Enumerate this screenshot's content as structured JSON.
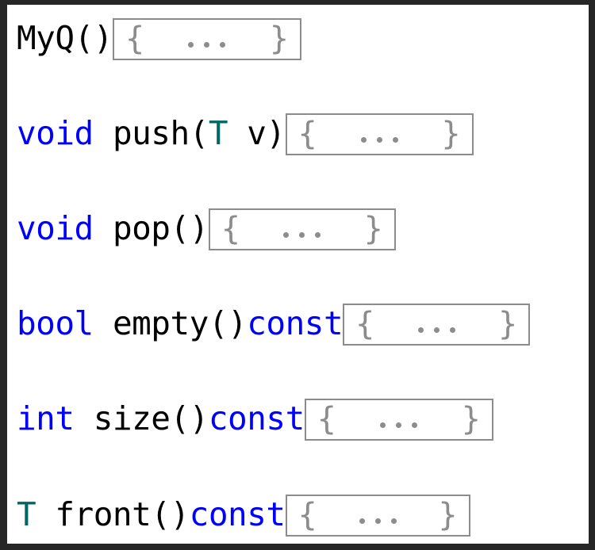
{
  "page": {
    "background_color": "#ffffff",
    "border_color": "#262626",
    "box_border_color": "#8c8c8c",
    "box_glyph_color": "#8c8c8c",
    "keyword_color": "#0000ff",
    "template_type_color": "#006666",
    "identifier_color": "#000000"
  },
  "code": {
    "language": "C++",
    "class_name": "MyQ",
    "members": [
      {
        "index": 0,
        "signature_text": "MyQ()",
        "tokens": [
          {
            "text": "MyQ",
            "kind": "identifier"
          },
          {
            "text": "()",
            "kind": "punctuation"
          }
        ],
        "body": {
          "open_brace": "{",
          "ellipsis": "...",
          "close_brace": "}",
          "dot_count": 3
        }
      },
      {
        "index": 1,
        "signature_text": "void push(T v)",
        "tokens": [
          {
            "text": "void",
            "kind": "keyword"
          },
          {
            "text": " ",
            "kind": "space"
          },
          {
            "text": "push(",
            "kind": "identifier"
          },
          {
            "text": "T",
            "kind": "template-type"
          },
          {
            "text": " v)",
            "kind": "identifier"
          }
        ],
        "body": {
          "open_brace": "{",
          "ellipsis": "...",
          "close_brace": "}",
          "dot_count": 3
        }
      },
      {
        "index": 2,
        "signature_text": "void pop()",
        "tokens": [
          {
            "text": "void",
            "kind": "keyword"
          },
          {
            "text": " ",
            "kind": "space"
          },
          {
            "text": "pop()",
            "kind": "identifier"
          }
        ],
        "body": {
          "open_brace": "{",
          "ellipsis": "...",
          "close_brace": "}",
          "dot_count": 3
        }
      },
      {
        "index": 3,
        "signature_text": "bool empty()const",
        "tokens": [
          {
            "text": "bool",
            "kind": "keyword"
          },
          {
            "text": " ",
            "kind": "space"
          },
          {
            "text": "empty()",
            "kind": "identifier"
          },
          {
            "text": "const",
            "kind": "keyword"
          }
        ],
        "body": {
          "open_brace": "{",
          "ellipsis": "...",
          "close_brace": "}",
          "dot_count": 3
        }
      },
      {
        "index": 4,
        "signature_text": "int size()const",
        "tokens": [
          {
            "text": "int",
            "kind": "keyword"
          },
          {
            "text": " ",
            "kind": "space"
          },
          {
            "text": "size()",
            "kind": "identifier"
          },
          {
            "text": "const",
            "kind": "keyword"
          }
        ],
        "body": {
          "open_brace": "{",
          "ellipsis": "...",
          "close_brace": "}",
          "dot_count": 3
        }
      },
      {
        "index": 5,
        "signature_text": "T front()const",
        "tokens": [
          {
            "text": "T",
            "kind": "template-type"
          },
          {
            "text": " ",
            "kind": "space"
          },
          {
            "text": "front()",
            "kind": "identifier"
          },
          {
            "text": "const",
            "kind": "keyword"
          }
        ],
        "body": {
          "open_brace": "{",
          "ellipsis": "...",
          "close_brace": "}",
          "dot_count": 3
        }
      }
    ]
  }
}
